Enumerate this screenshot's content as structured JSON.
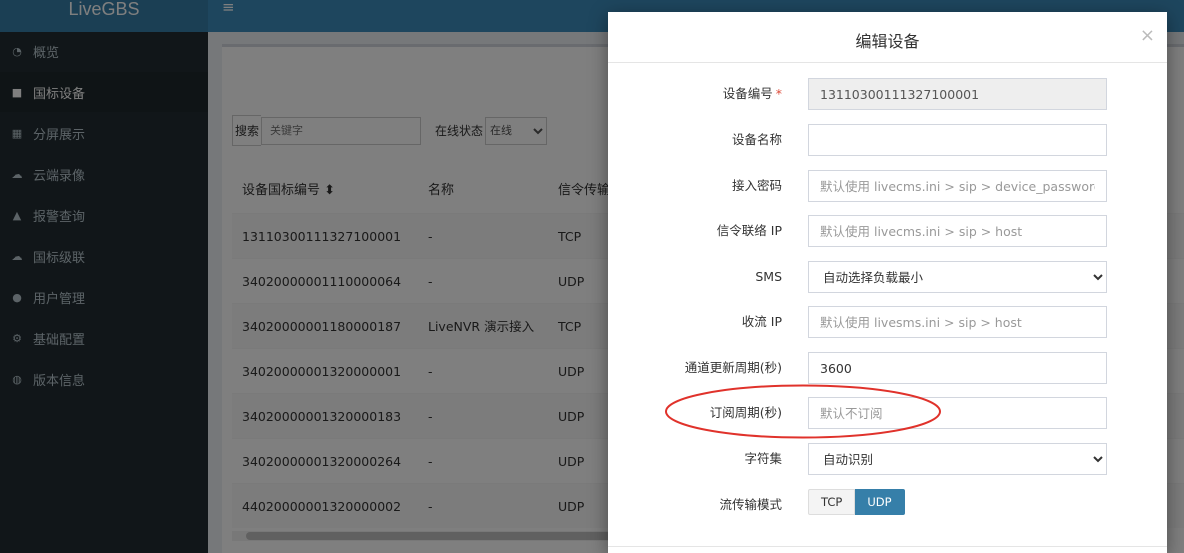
{
  "app": {
    "title": "LiveGBS"
  },
  "sidebar": {
    "items": [
      {
        "label": "概览",
        "icon": "dashboard-icon",
        "active": false
      },
      {
        "label": "国标设备",
        "icon": "video-camera-icon",
        "active": true
      },
      {
        "label": "分屏展示",
        "icon": "grid-icon",
        "active": false
      },
      {
        "label": "云端录像",
        "icon": "cloud-icon",
        "active": false
      },
      {
        "label": "报警查询",
        "icon": "bell-icon",
        "active": false
      },
      {
        "label": "国标级联",
        "icon": "cloud-upload-icon",
        "active": false
      },
      {
        "label": "用户管理",
        "icon": "users-icon",
        "active": false
      },
      {
        "label": "基础配置",
        "icon": "gears-icon",
        "active": false
      },
      {
        "label": "版本信息",
        "icon": "globe-icon",
        "active": false
      }
    ]
  },
  "toolbar": {
    "search_label": "搜索",
    "search_placeholder": "关键字",
    "status_label": "在线状态",
    "status_value": "在线"
  },
  "table": {
    "columns": [
      "设备国标编号 ⬍",
      "名称",
      "信令传输"
    ],
    "rows": [
      [
        "13110300111327100001",
        "-",
        "TCP"
      ],
      [
        "34020000001110000064",
        "-",
        "UDP"
      ],
      [
        "34020000001180000187",
        "LiveNVR 演示接入",
        "TCP"
      ],
      [
        "34020000001320000001",
        "-",
        "UDP"
      ],
      [
        "34020000001320000183",
        "-",
        "UDP"
      ],
      [
        "34020000001320000264",
        "-",
        "UDP"
      ],
      [
        "44020000001320000002",
        "-",
        "UDP"
      ]
    ]
  },
  "modal": {
    "title": "编辑设备",
    "close": "×",
    "fields": {
      "device_id": {
        "label": "设备编号",
        "required_mark": "*",
        "value": "13110300111327100001"
      },
      "device_name": {
        "label": "设备名称",
        "value": ""
      },
      "password": {
        "label": "接入密码",
        "placeholder": "默认使用 livecms.ini > sip > device_password"
      },
      "signal_ip": {
        "label": "信令联络 IP",
        "placeholder": "默认使用 livecms.ini > sip > host"
      },
      "sms": {
        "label": "SMS",
        "value": "自动选择负载最小"
      },
      "stream_ip": {
        "label": "收流 IP",
        "placeholder": "默认使用 livesms.ini > sip > host"
      },
      "channel_refresh": {
        "label": "通道更新周期(秒)",
        "value": "3600"
      },
      "subscribe_period": {
        "label": "订阅周期(秒)",
        "placeholder": "默认不订阅"
      },
      "charset": {
        "label": "字符集",
        "value": "自动识别"
      },
      "transport": {
        "label": "流传输模式",
        "options": [
          "TCP",
          "UDP"
        ],
        "selected": "UDP"
      }
    }
  },
  "colors": {
    "sidebar_bg": "#222d32",
    "accent": "#367fa9",
    "annotation": "#e0322b"
  }
}
